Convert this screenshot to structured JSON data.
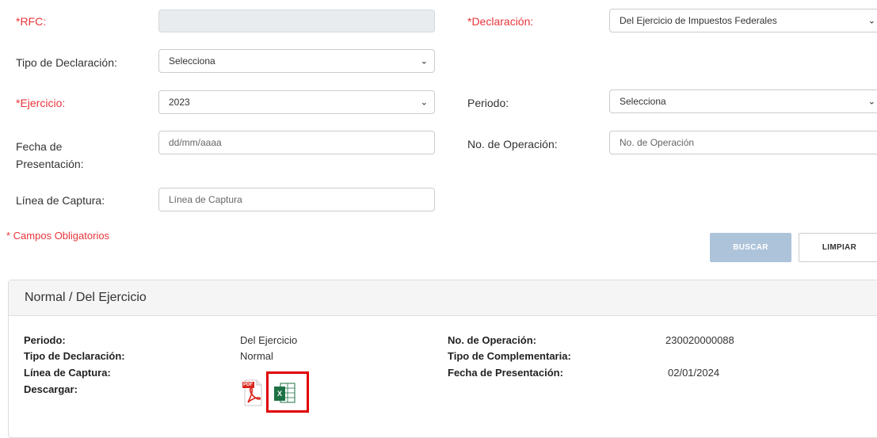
{
  "form": {
    "rfc": {
      "label": "*RFC:",
      "value": ""
    },
    "declaracion": {
      "label": "*Declaración:",
      "value": "Del Ejercicio de Impuestos Federales"
    },
    "tipo_declaracion": {
      "label": "Tipo de Declaración:",
      "value": "Selecciona"
    },
    "ejercicio": {
      "label": "*Ejercicio:",
      "value": "2023"
    },
    "periodo": {
      "label": "Periodo:",
      "value": "Selecciona"
    },
    "fecha_presentacion": {
      "label_line1": "Fecha de",
      "label_line2": "Presentación:",
      "placeholder": "dd/mm/aaaa"
    },
    "no_operacion": {
      "label": "No. de Operación:",
      "placeholder": "No. de Operación"
    },
    "linea_captura": {
      "label": "Línea de Captura:",
      "placeholder": "Línea de Captura"
    },
    "required_note": "* Campos Obligatorios",
    "search_label": "BUSCAR",
    "clear_label": "LIMPIAR"
  },
  "result": {
    "title": "Normal / Del Ejercicio",
    "periodo_label": "Periodo:",
    "periodo_value": "Del Ejercicio",
    "tipo_label": "Tipo de Declaración:",
    "tipo_value": "Normal",
    "linea_label": "Línea de Captura:",
    "descargar_label": "Descargar:",
    "no_op_label": "No. de Operación:",
    "no_op_value": "230020000088",
    "tipo_comp_label": "Tipo de Complementaria:",
    "fecha_label": "Fecha de Presentación:",
    "fecha_value": "02/01/2024",
    "pdf_icon_text": "PDF",
    "excel_icon_text": "X"
  },
  "colors": {
    "required": "#e8353b",
    "primary_button": "#adc3da",
    "highlight_box": "#e00000",
    "pdf_red": "#d9261c",
    "excel_green": "#1e7145"
  }
}
